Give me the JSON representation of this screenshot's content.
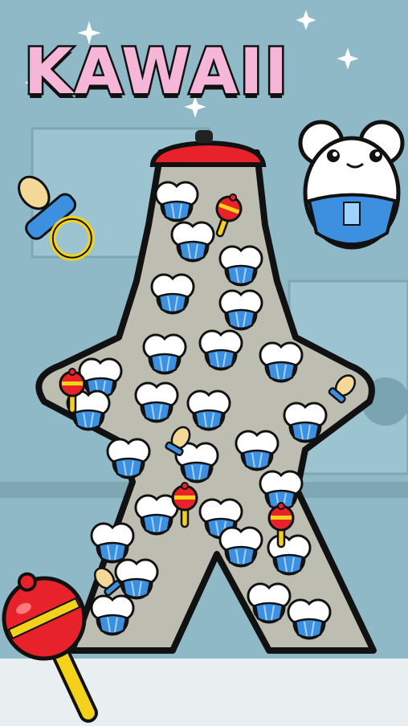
{
  "title": "KAWAII",
  "colors": {
    "background": "#8fb9c7",
    "title_fill": "#f6b6d8",
    "title_stroke": "#111111",
    "diaper_blue": "#3d8fe0",
    "rattle_red": "#e8222b",
    "rattle_yellow": "#f4d21b",
    "container_fill": "#bdbdb1",
    "cap_red": "#e8222b"
  },
  "icons": {
    "character": "kawaii-baby-icon",
    "pacifier": "pacifier-icon",
    "rattle": "rattle-icon",
    "jar": "star-jar-icon"
  }
}
